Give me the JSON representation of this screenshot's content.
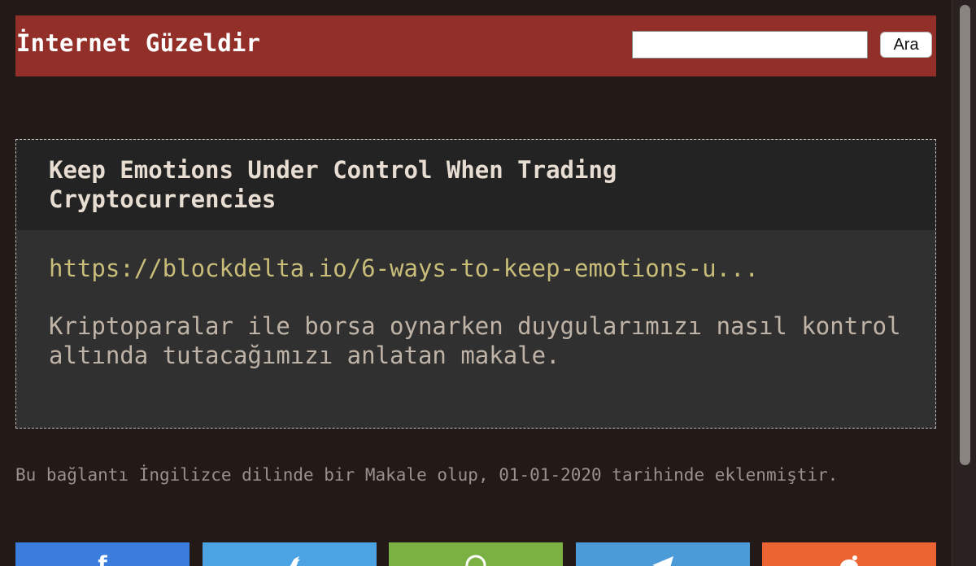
{
  "header": {
    "site_title": "İnternet Güzeldir",
    "search_placeholder": "",
    "search_value": "",
    "search_button_label": "Ara",
    "background_color": "#922f29"
  },
  "article": {
    "title": "Keep Emotions Under Control When Trading Cryptocurrencies",
    "url_text": "https://blockdelta.io/6-ways-to-keep-emotions-u...",
    "description": "Kriptoparalar ile borsa oynarken duygularımızı nasıl kontrol altında tutacağımızı anlatan makale."
  },
  "meta_text": "Bu bağlantı İngilizce dilinde bir Makale olup, 01-01-2020 tarihinde eklenmiştir.",
  "share_buttons": [
    {
      "icon": "facebook-icon",
      "color": "#3b7ddd"
    },
    {
      "icon": "twitter-icon",
      "color": "#4ba3e3"
    },
    {
      "icon": "whatsapp-icon",
      "color": "#7bb043"
    },
    {
      "icon": "telegram-icon",
      "color": "#4b9bd9"
    },
    {
      "icon": "reddit-icon",
      "color": "#ed6433"
    }
  ],
  "colors": {
    "page_background": "#231917",
    "title_text": "#e8ddd2",
    "url_text": "#c9bd7a",
    "description_text": "#bfb3a7"
  }
}
